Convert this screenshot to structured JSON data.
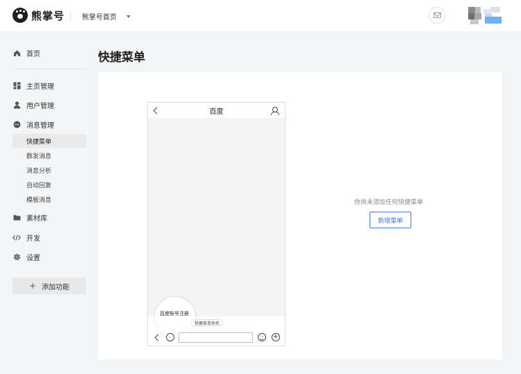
{
  "header": {
    "logo_text": "熊掌号",
    "account_switch_label": "熊掌号首页"
  },
  "sidebar": {
    "items": [
      {
        "label": "首页",
        "icon": "home-icon"
      },
      {
        "label": "主页管理",
        "icon": "grid-icon"
      },
      {
        "label": "用户管理",
        "icon": "user-icon"
      },
      {
        "label": "消息管理",
        "icon": "message-icon"
      },
      {
        "label": "素材库",
        "icon": "folder-icon"
      },
      {
        "label": "开发",
        "icon": "code-icon"
      },
      {
        "label": "设置",
        "icon": "gear-icon"
      }
    ],
    "sub_items": [
      {
        "label": "快捷菜单",
        "active": true
      },
      {
        "label": "群发消息",
        "active": false
      },
      {
        "label": "消息分析",
        "active": false
      },
      {
        "label": "自动回复",
        "active": false
      },
      {
        "label": "模板消息",
        "active": false
      }
    ],
    "add_function_label": "添加功能"
  },
  "main": {
    "page_title": "快捷菜单",
    "phone_preview": {
      "title": "百度",
      "menu_bubble": "百度账号注册",
      "menu_tag": "快捷菜单命名"
    },
    "empty_message": "你尚未添加任何快捷菜单",
    "new_menu_button": "新增菜单"
  },
  "colors": {
    "accent": "#3c76f1",
    "background": "#f4f5f6"
  }
}
